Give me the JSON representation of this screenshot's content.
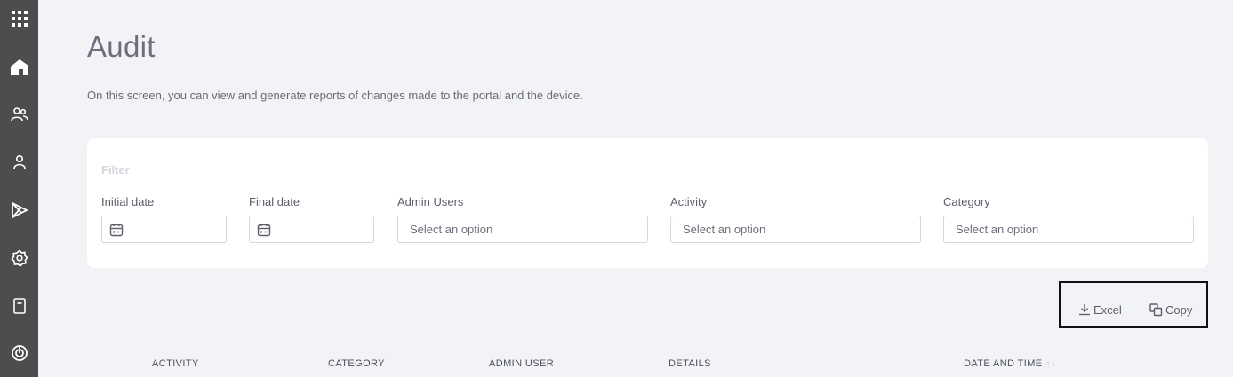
{
  "sidebar": {
    "items": [
      {
        "icon": "apps-grid-icon"
      },
      {
        "icon": "home-icon"
      },
      {
        "icon": "users-icon"
      },
      {
        "icon": "user-icon"
      },
      {
        "icon": "play-store-icon"
      },
      {
        "icon": "settings-gear-icon"
      },
      {
        "icon": "device-icon"
      },
      {
        "icon": "power-target-icon"
      }
    ]
  },
  "header": {
    "title": "Audit",
    "description": "On this screen, you can view and generate reports of changes made to the portal and the device."
  },
  "filter": {
    "title": "Filter",
    "initial_date_label": "Initial date",
    "final_date_label": "Final date",
    "admin_users_label": "Admin Users",
    "admin_users_placeholder": "Select an option",
    "activity_label": "Activity",
    "activity_placeholder": "Select an option",
    "category_label": "Category",
    "category_placeholder": "Select an option"
  },
  "export": {
    "excel_label": "Excel",
    "copy_label": "Copy"
  },
  "table": {
    "columns": [
      "ACTIVITY",
      "CATEGORY",
      "ADMIN USER",
      "DETAILS",
      "DATE AND TIME"
    ],
    "sort_glyph": "↑↓"
  },
  "colors": {
    "sidebar": "#4d4d4f",
    "background": "#f2f3f7",
    "card": "#ffffff",
    "highlight_border": "#111111"
  }
}
